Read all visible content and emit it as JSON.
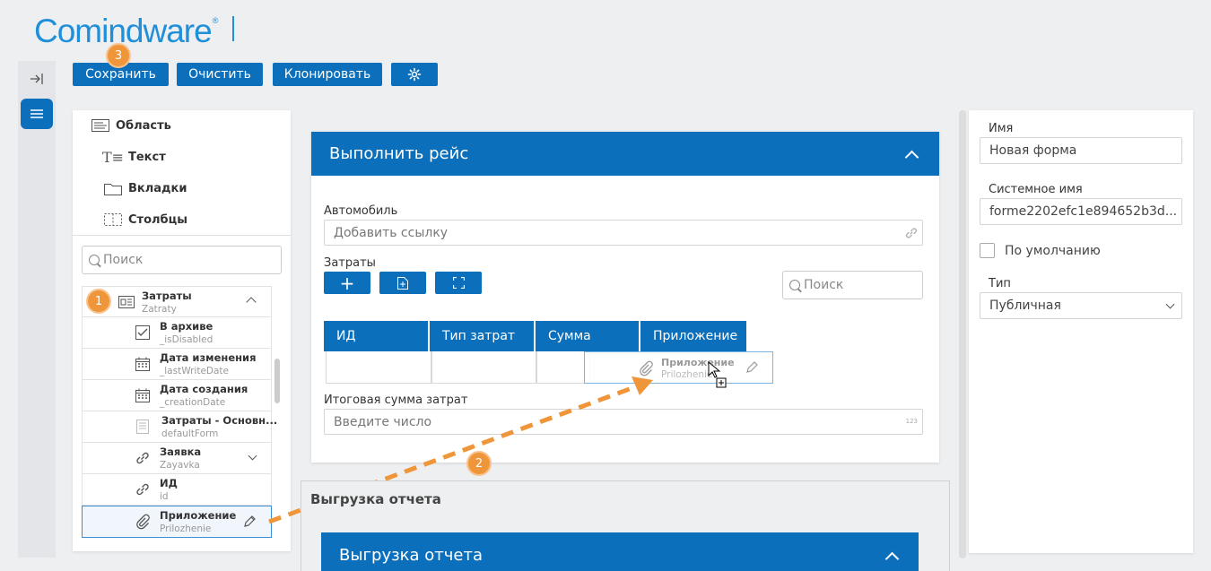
{
  "header": {
    "logo_text": "Comindware",
    "logo_mark": "®"
  },
  "toolbar": {
    "save_label": "Сохранить",
    "clear_label": "Очистить",
    "clone_label": "Клонировать",
    "settings_icon": "gear-icon",
    "badge_save": "3"
  },
  "rail": {
    "collapse_icon": "arrow-right-bar-icon",
    "menu_icon": "hamburger-icon"
  },
  "toolbox": {
    "items": [
      {
        "label": "Область",
        "icon": "area-icon"
      },
      {
        "label": "Текст",
        "icon": "text-icon"
      },
      {
        "label": "Вкладки",
        "icon": "folder-tab-icon"
      },
      {
        "label": "Столбцы",
        "icon": "columns-icon"
      }
    ],
    "search_placeholder": "Поиск"
  },
  "tree": {
    "badge": "1",
    "rows": [
      {
        "name": "Затраты",
        "sys": "Zatraty",
        "icon": "record-icon"
      },
      {
        "name": "В архиве",
        "sys": "_isDisabled",
        "icon": "checkbox-icon"
      },
      {
        "name": "Дата изменения",
        "sys": "_lastWriteDate",
        "icon": "calendar-icon"
      },
      {
        "name": "Дата создания",
        "sys": "_creationDate",
        "icon": "calendar-icon"
      },
      {
        "name": "Затраты - Основн...",
        "sys": "defaultForm",
        "icon": "form-icon"
      },
      {
        "name": "Заявка",
        "sys": "Zayavka",
        "icon": "link-icon"
      },
      {
        "name": "ИД",
        "sys": "id",
        "icon": "link-icon"
      },
      {
        "name": "Приложение",
        "sys": "Prilozhenie",
        "icon": "paperclip-icon"
      }
    ]
  },
  "form": {
    "title": "Выполнить рейс",
    "auto_label": "Автомобиль",
    "auto_placeholder": "Добавить ссылку",
    "costs_label": "Затраты",
    "costs_search_placeholder": "Поиск",
    "grid_columns": [
      "ИД",
      "Тип затрат",
      "Сумма",
      "Приложение"
    ],
    "total_label": "Итоговая сумма затрат",
    "total_placeholder": "Введите число",
    "total_hint": "123"
  },
  "drag": {
    "name": "Приложение",
    "sys": "Prilozhenie",
    "badge": "2"
  },
  "section2": {
    "title": "Выгрузка отчета",
    "card_title": "Выгрузка отчета"
  },
  "props": {
    "name_label": "Имя",
    "name_value": "Новая форма",
    "sysname_label": "Системное имя",
    "sysname_value": "forme2202efc1e894652b3d...",
    "default_label": "По умолчанию",
    "type_label": "Тип",
    "type_value": "Публичная"
  },
  "colors": {
    "brand": "#1e8fd8",
    "primary": "#0b6fbc",
    "badge": "#f0963a",
    "arrow": "#f0963a"
  }
}
